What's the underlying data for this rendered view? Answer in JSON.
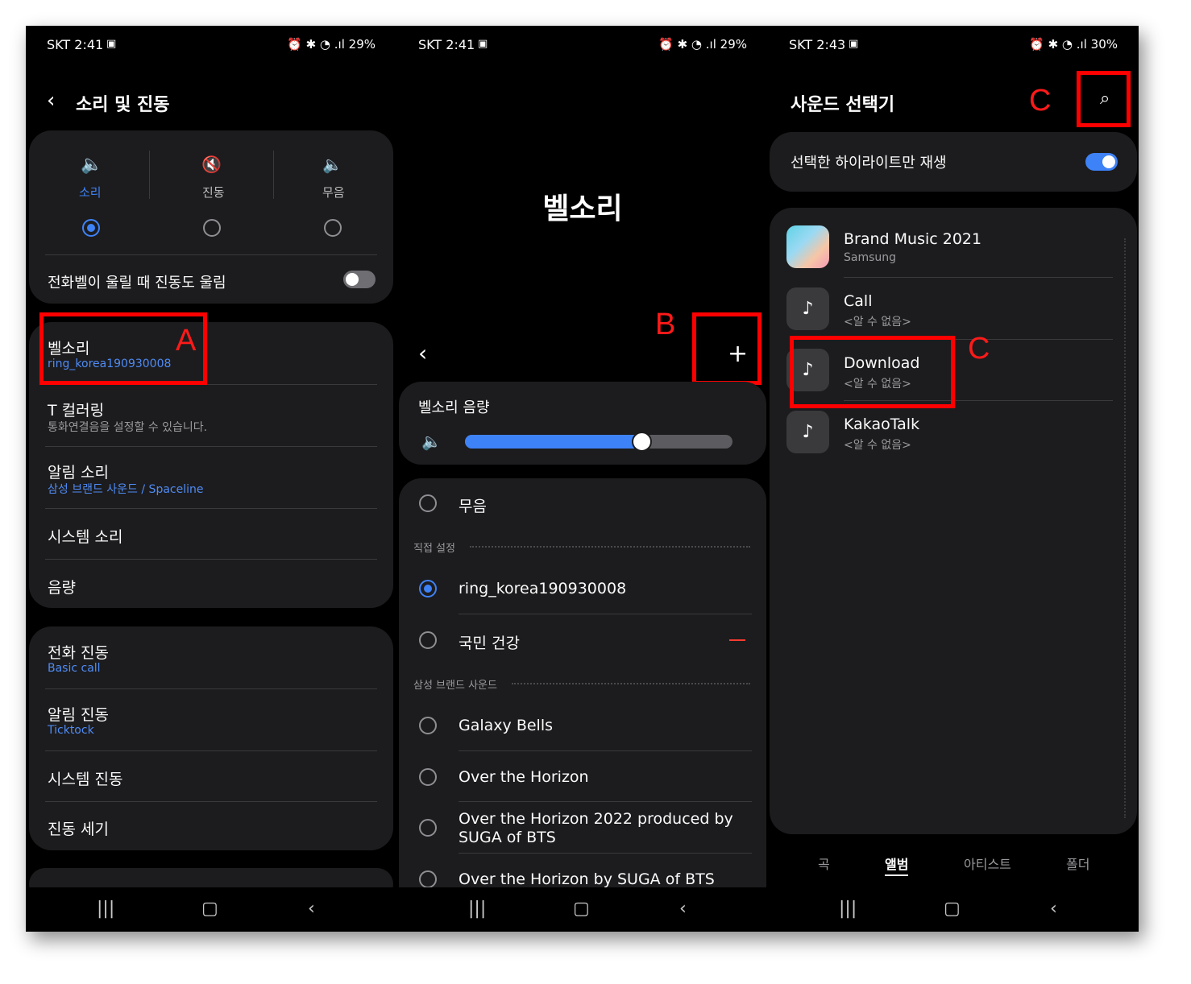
{
  "panel1": {
    "status": {
      "carrier_time": "SKT 2:41",
      "battery": "29%"
    },
    "header": {
      "title": "소리 및 진동"
    },
    "modes": [
      {
        "label": "소리",
        "selected": true
      },
      {
        "label": "진동",
        "selected": false
      },
      {
        "label": "무음",
        "selected": false
      }
    ],
    "vibrate_ring": {
      "label": "전화벨이 울릴 때 진동도 울림",
      "enabled": false
    },
    "settings": [
      {
        "title": "벨소리",
        "subtitle": "ring_korea190930008"
      },
      {
        "title": "T 컬러링",
        "subtitle": "통화연결음을 설정할 수 있습니다."
      },
      {
        "title": "알림 소리",
        "subtitle": "삼성 브랜드 사운드 / Spaceline"
      },
      {
        "title": "시스템 소리",
        "subtitle": ""
      },
      {
        "title": "음량",
        "subtitle": ""
      }
    ],
    "vibration": [
      {
        "title": "전화 진동",
        "subtitle": "Basic call"
      },
      {
        "title": "알림 진동",
        "subtitle": "Ticktock"
      },
      {
        "title": "시스템 진동",
        "subtitle": ""
      },
      {
        "title": "진동 세기",
        "subtitle": ""
      }
    ],
    "annotation": "A"
  },
  "panel2": {
    "status": {
      "carrier_time": "SKT 2:41",
      "battery": "29%"
    },
    "title": "벨소리",
    "volume": {
      "label": "벨소리 음량",
      "level": 0.66
    },
    "silent_label": "무음",
    "custom_section": "직접 설정",
    "custom_items": [
      {
        "label": "ring_korea190930008",
        "selected": true
      },
      {
        "label": "국민 건강",
        "selected": false
      }
    ],
    "brand_section": "삼성 브랜드 사운드",
    "brand_items": [
      {
        "label": "Galaxy Bells"
      },
      {
        "label": "Over the Horizon"
      },
      {
        "label": "Over the Horizon 2022 produced by SUGA of BTS"
      },
      {
        "label": "Over the Horizon by SUGA of BTS"
      }
    ],
    "annotation": "B"
  },
  "panel3": {
    "status": {
      "carrier_time": "SKT 2:43",
      "battery": "30%"
    },
    "title": "사운드 선택기",
    "highlight_toggle": {
      "label": "선택한 하이라이트만 재생",
      "enabled": true
    },
    "albums": [
      {
        "title": "Brand Music 2021",
        "subtitle": "Samsung"
      },
      {
        "title": "Call",
        "subtitle": "<알 수 없음>"
      },
      {
        "title": "Download",
        "subtitle": "<알 수 없음>"
      },
      {
        "title": "KakaoTalk",
        "subtitle": "<알 수 없음>"
      }
    ],
    "tabs": [
      {
        "label": "곡",
        "active": false
      },
      {
        "label": "앨범",
        "active": true
      },
      {
        "label": "아티스트",
        "active": false
      },
      {
        "label": "폴더",
        "active": false
      }
    ],
    "annotation_search": "C",
    "annotation_download": "C"
  },
  "colors": {
    "accent": "#3e82f7",
    "annotation": "#ff0000",
    "background": "#000000",
    "card": "#1c1c1e"
  }
}
